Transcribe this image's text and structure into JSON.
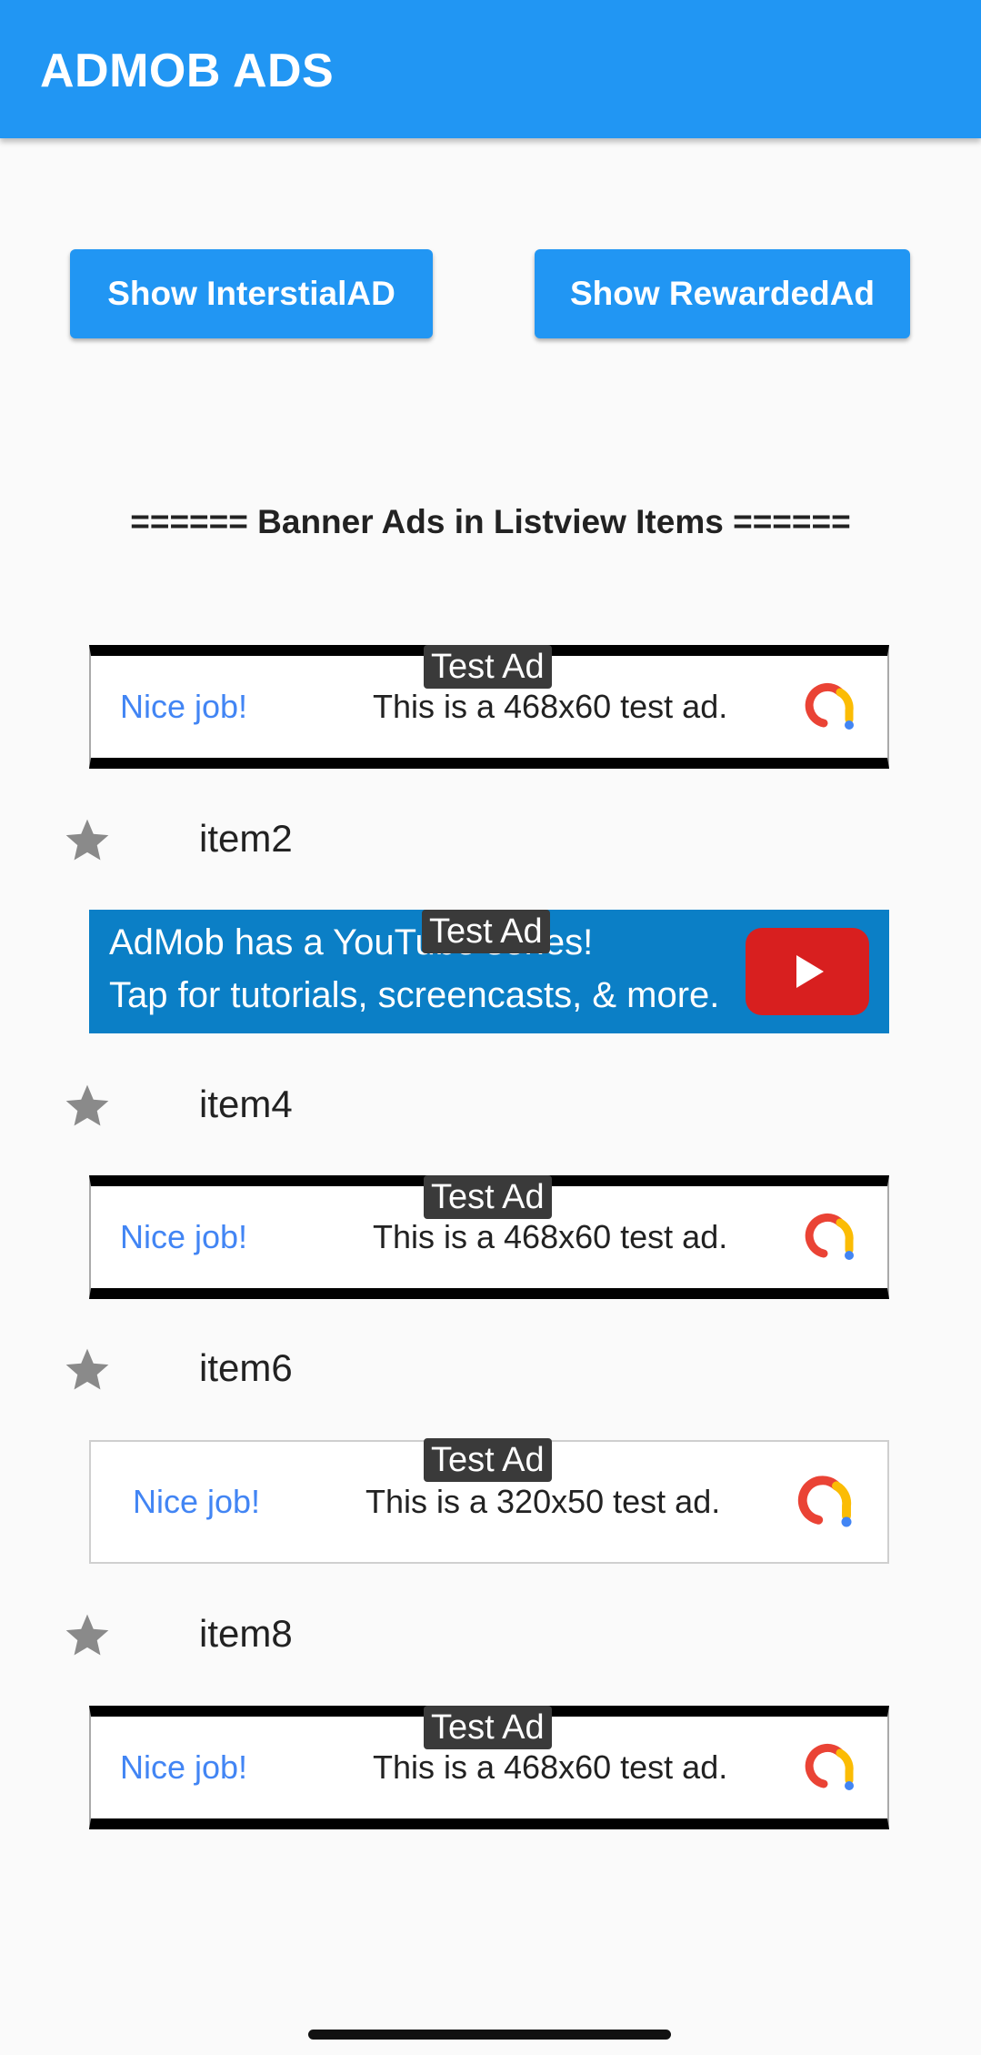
{
  "app_bar": {
    "title": "ADMOB ADS",
    "color": "#2196f3"
  },
  "buttons": {
    "interstitial_label": "Show InterstialAD",
    "rewarded_label": "Show RewardedAd"
  },
  "section_title": "====== Banner Ads in Listview Items ======",
  "ads": [
    {
      "badge": "Test Ad",
      "headline": "Nice job!",
      "text": "This is a 468x60 test ad.",
      "logo": "admob-logo-icon"
    },
    {
      "badge": "Test Ad",
      "line1": "AdMob has a YouTube series!",
      "line2": "Tap for tutorials, screencasts, & more.",
      "logo": "youtube-play-icon"
    },
    {
      "badge": "Test Ad",
      "headline": "Nice job!",
      "text": "This is a 468x60 test ad.",
      "logo": "admob-logo-icon"
    },
    {
      "badge": "Test Ad",
      "headline": "Nice job!",
      "text": "This is a 320x50 test ad.",
      "logo": "admob-logo-icon"
    },
    {
      "badge": "Test Ad",
      "headline": "Nice job!",
      "text": "This is a 468x60 test ad.",
      "logo": "admob-logo-icon"
    }
  ],
  "items": [
    {
      "label": "item2",
      "icon": "star-icon"
    },
    {
      "label": "item4",
      "icon": "star-icon"
    },
    {
      "label": "item6",
      "icon": "star-icon"
    },
    {
      "label": "item8",
      "icon": "star-icon"
    }
  ]
}
